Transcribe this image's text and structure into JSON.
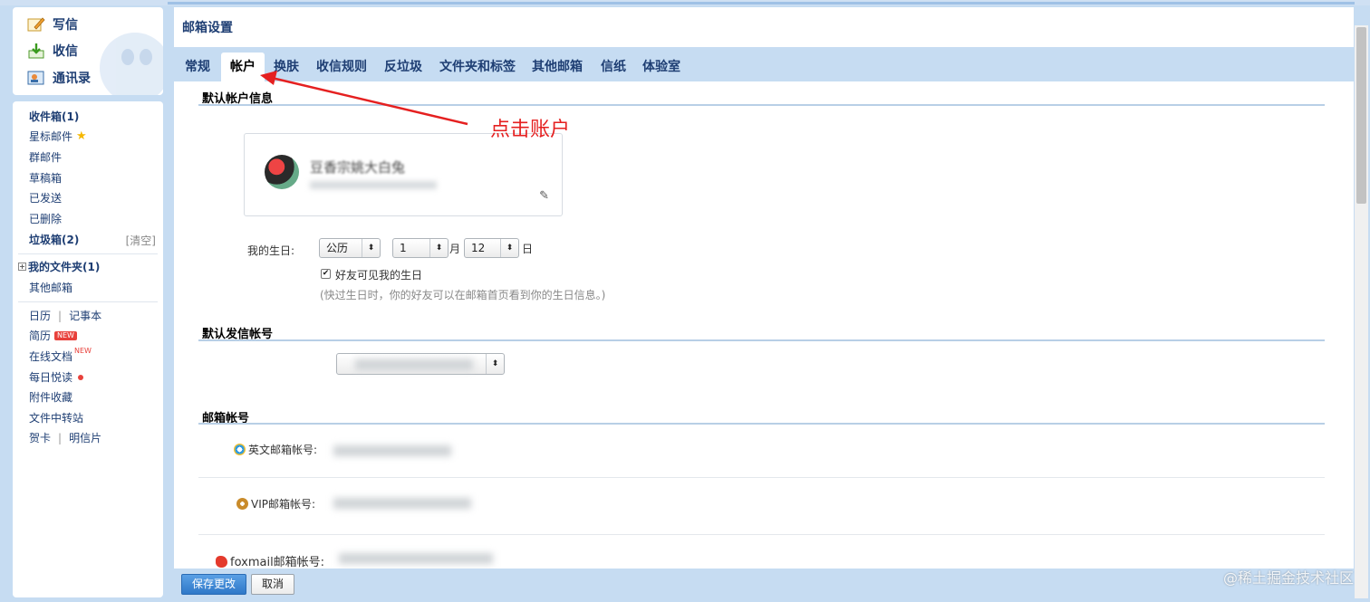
{
  "compose": {
    "write": "写信",
    "receive": "收信",
    "contacts": "通讯录"
  },
  "folders": {
    "inbox": "收件箱(1)",
    "starred": "星标邮件",
    "group": "群邮件",
    "drafts": "草稿箱",
    "sent": "已发送",
    "deleted": "已删除",
    "spam": "垃圾箱(2)",
    "spam_clear": "[清空]",
    "my_folders": "我的文件夹(1)",
    "other_mailbox": "其他邮箱",
    "calendar": "日历",
    "notes": "记事本",
    "resume": "简历",
    "new_badge": "NEW",
    "online_docs": "在线文档",
    "daily_reading": "每日悦读",
    "attachments": "附件收藏",
    "file_transfer": "文件中转站",
    "cards": "贺卡",
    "postcards": "明信片",
    "separator": "|"
  },
  "settings": {
    "title": "邮箱设置",
    "tabs": [
      "常规",
      "帐户",
      "换肤",
      "收信规则",
      "反垃圾",
      "文件夹和标签",
      "其他邮箱",
      "信纸",
      "体验室"
    ],
    "active_tab": "帐户"
  },
  "account": {
    "section_default": "默认帐户信息",
    "nickname": "豆香宗姚大白兔",
    "birthday_label": "我的生日:",
    "calendar_type": "公历",
    "month": "1",
    "month_unit": "月",
    "day": "12",
    "day_unit": "日",
    "friends_visible": "好友可见我的生日",
    "friends_visible_checked": true,
    "birthday_hint": "(快过生日时，你的好友可以在邮箱首页看到你的生日信息。)",
    "section_sender": "默认发信帐号",
    "section_accounts": "邮箱帐号",
    "english_label": "英文邮箱帐号:",
    "vip_label": "VIP邮箱帐号:",
    "foxmail_label": "foxmail邮箱帐号:"
  },
  "footer": {
    "save": "保存更改",
    "cancel": "取消"
  },
  "annotation": "点击账户",
  "watermark": "@稀土掘金技术社区",
  "colors": {
    "frame": "#c6dcf2",
    "nav_text": "#1e3e73",
    "annotation_red": "#e52020",
    "save_button": "#2f78c8"
  }
}
